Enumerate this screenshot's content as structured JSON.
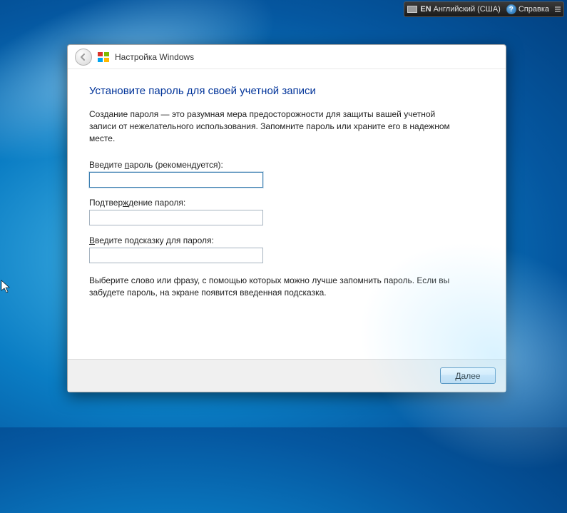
{
  "lang_bar": {
    "lang_code": "EN",
    "lang_name": "Английский (США)",
    "help_symbol": "?",
    "help_label": "Справка"
  },
  "window": {
    "title": "Настройка Windows",
    "heading": "Установите пароль для своей учетной записи",
    "description": "Создание пароля — это разумная мера предосторожности для защиты вашей учетной записи от нежелательного использования. Запомните пароль или храните его в надежном месте.",
    "password_label_pre": "Введите ",
    "password_label_u": "п",
    "password_label_post": "ароль (рекомендуется):",
    "password_value": "",
    "confirm_label_pre": "Подтвер",
    "confirm_label_u": "ж",
    "confirm_label_post": "дение пароля:",
    "confirm_value": "",
    "hint_label_pre": "",
    "hint_label_u": "В",
    "hint_label_post": "ведите подсказку для пароля:",
    "hint_value": "",
    "hint_description": "Выберите слово или фразу, с помощью которых можно лучше запомнить пароль. Если вы забудете пароль, на экране появится введенная подсказка.",
    "next_label_u": "Д",
    "next_label_post": "алее"
  }
}
